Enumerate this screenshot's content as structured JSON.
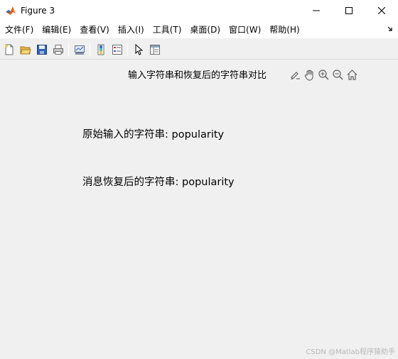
{
  "window": {
    "title": "Figure 3",
    "icon": "matlab-icon",
    "controls": [
      "minimize-icon",
      "maximize-icon",
      "close-icon"
    ]
  },
  "menu": {
    "items": [
      {
        "label": "文件(F)"
      },
      {
        "label": "编辑(E)"
      },
      {
        "label": "查看(V)"
      },
      {
        "label": "插入(I)"
      },
      {
        "label": "工具(T)"
      },
      {
        "label": "桌面(D)"
      },
      {
        "label": "窗口(W)"
      },
      {
        "label": "帮助(H)"
      }
    ]
  },
  "toolbar": {
    "icons": [
      "new-figure-icon",
      "open-file-icon",
      "save-icon",
      "print-icon",
      "link-plot-icon",
      "colorbar-icon",
      "legend-icon",
      "select-arrow-icon",
      "property-inspector-icon"
    ]
  },
  "axes": {
    "title": "输入字符串和恢复后的字符串对比",
    "toolbar_icons": [
      "brush-icon",
      "pan-hand-icon",
      "zoom-in-icon",
      "zoom-out-icon",
      "home-icon"
    ]
  },
  "figure_text": {
    "original": "原始输入的字符串: popularity",
    "recovered": "消息恢复后的字符串: popularity"
  },
  "watermark": "CSDN @Matlab程序猿助手",
  "colors": {
    "background": "#f0f0f0",
    "titlebar": "#ffffff",
    "text": "#000000"
  }
}
